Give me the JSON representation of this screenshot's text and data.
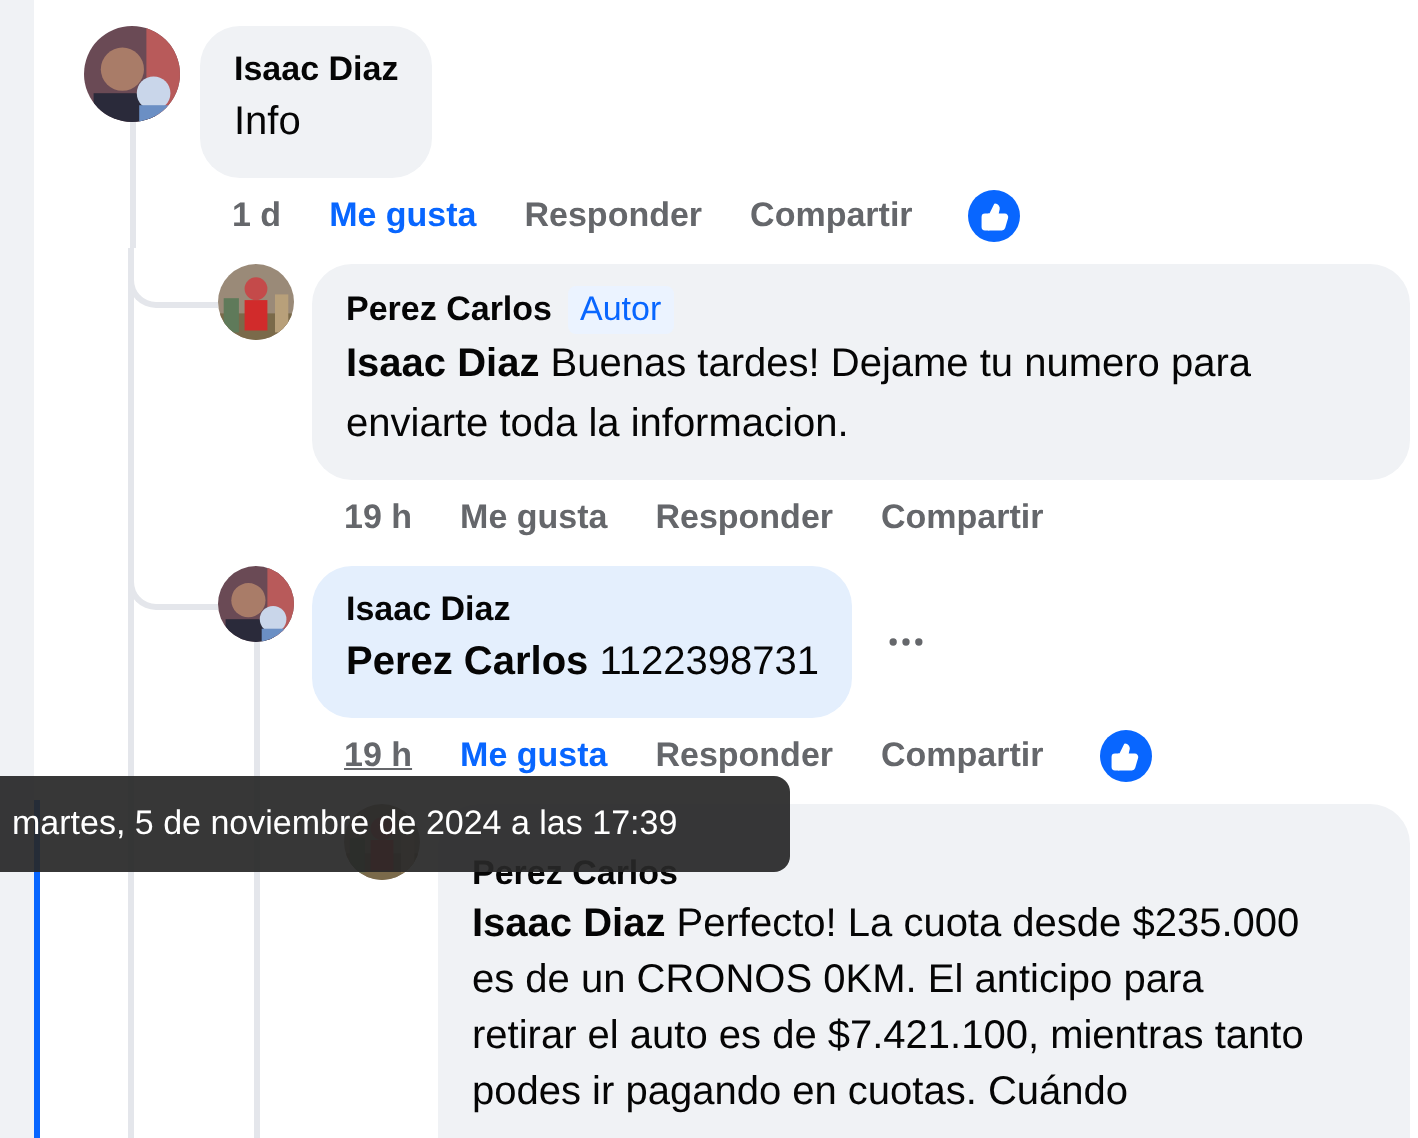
{
  "tooltip": {
    "text": "martes, 5 de noviembre de 2024 a las 17:39"
  },
  "comments": [
    {
      "author": "Isaac Diaz",
      "avatar": {
        "kind": "picture"
      },
      "text": "Info",
      "highlighted": false,
      "actions": {
        "time": "1 d",
        "time_hovered": false,
        "like": "Me gusta",
        "liked": true,
        "reply": "Responder",
        "share": "Compartir",
        "reaction": true
      },
      "children": [
        {
          "author": "Perez Carlos",
          "badge": "Autor",
          "avatar": {
            "kind": "picture"
          },
          "text": "**Isaac Diaz** Buenas tardes! Dejame tu numero para enviarte toda la informacion.",
          "highlighted": false,
          "actions": {
            "time": "19 h",
            "time_hovered": false,
            "like": "Me gusta",
            "liked": false,
            "reply": "Responder",
            "share": "Compartir",
            "reaction": false
          }
        },
        {
          "author": "Isaac Diaz",
          "avatar": {
            "kind": "picture"
          },
          "text": "**Perez Carlos** 1122398731",
          "highlighted": true,
          "more_menu": true,
          "actions": {
            "time": "19 h",
            "time_hovered": true,
            "like": "Me gusta",
            "liked": true,
            "reply": "Responder",
            "share": "Compartir",
            "reaction": true
          },
          "children": [
            {
              "author": "Perez Carlos",
              "avatar": {
                "kind": "picture"
              },
              "text": "**Isaac Diaz** Perfecto! La cuota desde $235.000 es de un CRONOS 0KM. El anticipo para retirar el auto es de $7.421.100, mientras tanto podes ir pagando en cuotas. Cuándo",
              "highlighted": false
            }
          ]
        }
      ]
    }
  ]
}
